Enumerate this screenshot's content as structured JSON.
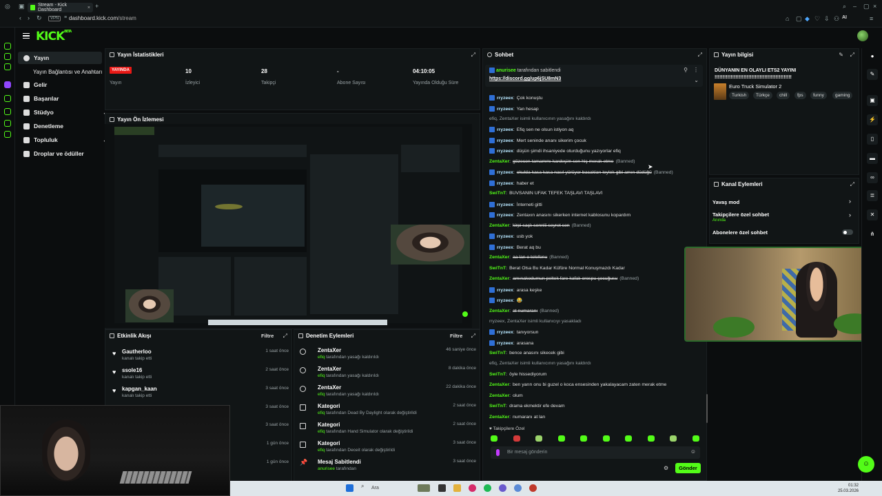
{
  "browser": {
    "tab_title": "Stream - Kick Dashboard",
    "url_host": "dashboard.kick.com",
    "url_path": "/stream",
    "vpn": "VPN",
    "ai": "AI"
  },
  "app": {
    "logo": "KICK",
    "logo_sup": "BETA",
    "accent": "#53fc18"
  },
  "sidebar": {
    "items": [
      {
        "label": "Yayın",
        "icon": "broadcast-icon"
      },
      {
        "label": "Yayın Bağlantısı ve Anahtarı",
        "icon": ""
      },
      {
        "label": "Gelir",
        "icon": "money-icon"
      },
      {
        "label": "Başarılar",
        "icon": "trophy-icon"
      },
      {
        "label": "Stüdyo",
        "icon": "studio-icon"
      },
      {
        "label": "Denetleme",
        "icon": "shield-icon"
      },
      {
        "label": "Topluluk",
        "icon": "users-icon"
      },
      {
        "label": "Droplar ve ödüller",
        "icon": "gift-icon"
      }
    ]
  },
  "stats": {
    "title": "Yayın İstatistikleri",
    "live_badge": "YAYINDA",
    "items": [
      {
        "value": "",
        "label": "Yayın"
      },
      {
        "value": "10",
        "label": "İzleyici"
      },
      {
        "value": "28",
        "label": "Takipçi"
      },
      {
        "value": "-",
        "label": "Abone Sayısı"
      },
      {
        "value": "04:10:05",
        "label": "Yayında Olduğu Süre"
      }
    ]
  },
  "preview": {
    "title": "Yayın Ön İzlemesi"
  },
  "activity": {
    "title": "Etkinlik Akışı",
    "filter": "Filtre",
    "items": [
      {
        "name": "Gautherloo",
        "sub": "kanalı takip etti",
        "time": "1 saat önce"
      },
      {
        "name": "ssole16",
        "sub": "kanalı takip etti",
        "time": "2 saat önce"
      },
      {
        "name": "kapgan_kaan",
        "sub": "kanalı takip etti",
        "time": "3 saat önce"
      },
      {
        "name": "",
        "sub": "",
        "time": "3 saat önce"
      },
      {
        "name": "",
        "sub": "",
        "time": "3 saat önce"
      },
      {
        "name": "",
        "sub": "",
        "time": "1 gün önce"
      },
      {
        "name": "",
        "sub": "",
        "time": "1 gün önce"
      }
    ]
  },
  "moderation": {
    "title": "Denetim Eylemleri",
    "filter": "Filtre",
    "items": [
      {
        "name": "ZentaXer",
        "actor": "efiq",
        "rest": " tarafından yasağı kaldırıldı",
        "time": "46 saniye önce"
      },
      {
        "name": "ZentaXer",
        "actor": "efiq",
        "rest": " tarafından yasağı kaldırıldı",
        "time": "8 dakika önce"
      },
      {
        "name": "ZentaXer",
        "actor": "efiq",
        "rest": " tarafından yasağı kaldırıldı",
        "time": "22 dakika önce"
      },
      {
        "name": "Kategori",
        "actor": "efiq",
        "rest": " tarafından Dead By Daylight olarak değiştirildi",
        "time": "2 saat önce"
      },
      {
        "name": "Kategori",
        "actor": "efiq",
        "rest": " tarafından Hand Simulator olarak değiştirildi",
        "time": "2 saat önce"
      },
      {
        "name": "Kategori",
        "actor": "efiq",
        "rest": " tarafından Deceit olarak değiştirildi",
        "time": "3 saat önce"
      },
      {
        "name": "Mesaj Sabitlendi",
        "actor": "anurisee",
        "rest": " tarafından",
        "time": "3 saat önce"
      }
    ]
  },
  "chat": {
    "title": "Sohbet",
    "pinned_by": "anurisee",
    "pinned_by_suffix": " tarafından sabitlendi",
    "pinned_link": "https://discord.gg/up6jSU8mN3",
    "messages": [
      {
        "user": "rryzeex",
        "text": "Çok konuştu",
        "style": "normal"
      },
      {
        "user": "rryzeex",
        "text": "Yan hesap",
        "style": "normal"
      },
      {
        "user": "",
        "text": "efiq, ZentaXer isimli kullanıcının yasağını kaldırdı",
        "style": "system"
      },
      {
        "user": "rryzeex",
        "text": "Efiq sen ne olsun istiyon aq",
        "style": "normal"
      },
      {
        "user": "rryzeex",
        "text": "Mert seninde ananı sikerim çocuk",
        "style": "normal"
      },
      {
        "user": "rryzeex",
        "text": "düşün şimdi ihsaniyede oturduğunu yazıyorlar efiq",
        "style": "normal"
      },
      {
        "user": "ZentaXer",
        "text": "gözecen tamammı kardeşim sen hiç merak etme",
        "style": "banned",
        "tag": "(Banned)"
      },
      {
        "user": "rryzeex",
        "text": "okulda kasa kasa nasıl yürüyor bacakları leylek gibi amın düdüğü",
        "style": "banned",
        "tag": "(Banned)"
      },
      {
        "user": "rryzeex",
        "text": "haber et",
        "style": "normal"
      },
      {
        "user": "SwiTnT",
        "text": "BUVSANIN UFAK TEFEK TAŞLAVI TAŞLAVI",
        "style": "green"
      },
      {
        "user": "rryzeex",
        "text": "İnterneti gitti",
        "style": "normal"
      },
      {
        "user": "rryzeex",
        "text": "Zentaxın anasını sikerken internet kablosunu kopardım",
        "style": "normal"
      },
      {
        "user": "ZentaXer",
        "text": "kirpi saçlı sennlii seyret sen",
        "style": "banned",
        "tag": "(Banned)"
      },
      {
        "user": "rryzeex",
        "text": "usb yok",
        "style": "normal"
      },
      {
        "user": "rryzeex",
        "text": "Berat aq bu",
        "style": "normal"
      },
      {
        "user": "ZentaXer",
        "text": "aa lan o telefonu",
        "style": "banned",
        "tag": "(Banned)"
      },
      {
        "user": "SwiTnT",
        "text": "Berat Olsa Bu Kadar Küfüre Normal Konuşmazdı Kadar",
        "style": "green"
      },
      {
        "user": "ZentaXer",
        "text": "amınakodumun peltek fare kafalı orospu çocuğusu",
        "style": "banned",
        "tag": "(Banned)"
      },
      {
        "user": "rryzeex",
        "text": "arasa keşke",
        "style": "normal"
      },
      {
        "user": "rryzeex",
        "text": "😂",
        "style": "normal"
      },
      {
        "user": "ZentaXer",
        "text": "at numaranı",
        "style": "banned",
        "tag": "(Banned)"
      },
      {
        "user": "",
        "text": "rryzeex, ZentaXer isimli kullanıcıyı yasakladı",
        "style": "system"
      },
      {
        "user": "rryzeex",
        "text": "tanıyorsun",
        "style": "normal"
      },
      {
        "user": "rryzeex",
        "text": "arasana",
        "style": "normal"
      },
      {
        "user": "SwiTnT",
        "text": "bence anasını sikecek gibi",
        "style": "green"
      },
      {
        "user": "",
        "text": "efiq, ZentaXer isimli kullanıcının yasağını kaldırdı",
        "style": "system"
      },
      {
        "user": "SwiTnT",
        "text": "öyle hissediyorum",
        "style": "green"
      },
      {
        "user": "ZentaXer",
        "text": "ben yarın onu bi guzel o koca ensesinden yakalayacam zaten merak etme",
        "style": "green"
      },
      {
        "user": "ZentaXer",
        "text": "olum",
        "style": "green"
      },
      {
        "user": "SwiTnT",
        "text": "drama ekmektir efe devam",
        "style": "green"
      },
      {
        "user": "ZentaXer",
        "text": "numaranı at lan",
        "style": "green"
      }
    ],
    "emote_section": "Takipçilere Özel",
    "input_placeholder": "Bir mesaj gönderin",
    "send_label": "Gönder"
  },
  "stream_info": {
    "title": "Yayın bilgisi",
    "stream_title": "DÜNYANIN EN OLAYLI ETS2 YAYINI",
    "stream_title_line2": "!!!!!!!!!!!!!!!!!!!!!!!!!!!!!!!!!!!!!!!!!!!!!!!!",
    "category": "Euro Truck Simulator 2",
    "tags": [
      "Turkish",
      "Türkçe",
      "chill",
      "fps",
      "funny",
      "gaming"
    ]
  },
  "channel_actions": {
    "title": "Kanal Eylemleri",
    "items": [
      {
        "label": "Yavaş mod",
        "sub": ""
      },
      {
        "label": "Takipçilere özel sohbet",
        "sub": "Anında"
      },
      {
        "label": "Abonelere özel sohbet",
        "sub": ""
      }
    ]
  },
  "taskbar": {
    "search": "Ara",
    "time": "01:32",
    "date": "25.03.2026"
  }
}
